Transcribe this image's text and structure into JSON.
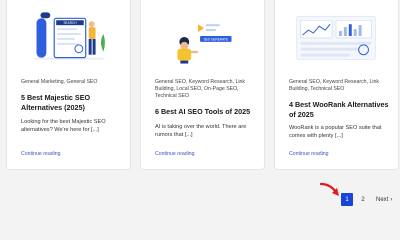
{
  "posts": [
    {
      "categories": "General Marketing, General SEO",
      "title": "5 Best Majestic SEO Alternatives (2025)",
      "excerpt": "Looking for the best Majestic SEO alternatives? We're here for [...]",
      "thumb_text": "SEARCH",
      "read_more": "Continue reading"
    },
    {
      "categories": "General SEO, Keyword Research, Link Building, Local SEO, On-Page SEO, Technical SEO",
      "title": "6 Best AI SEO Tools of 2025",
      "excerpt": "AI is taking over the world. There are rumors that [...]",
      "thumb_text": "SEO GENERATE",
      "read_more": "Continue reading"
    },
    {
      "categories": "General SEO, Keyword Research, Link Building, Technical SEO",
      "title": "4 Best WooRank Alternatives of 2025",
      "excerpt": "WooRank is a popular SEO suite that comes with plenty [...]",
      "read_more": "Continue reading"
    }
  ],
  "pagination": {
    "current": "1",
    "next_page": "2",
    "next_label": "Next",
    "next_icon": "chevron-right-icon",
    "chevron": "›"
  },
  "colors": {
    "accent": "#1a44d6",
    "link": "#3a57c9",
    "arrow": "#e0191f"
  }
}
